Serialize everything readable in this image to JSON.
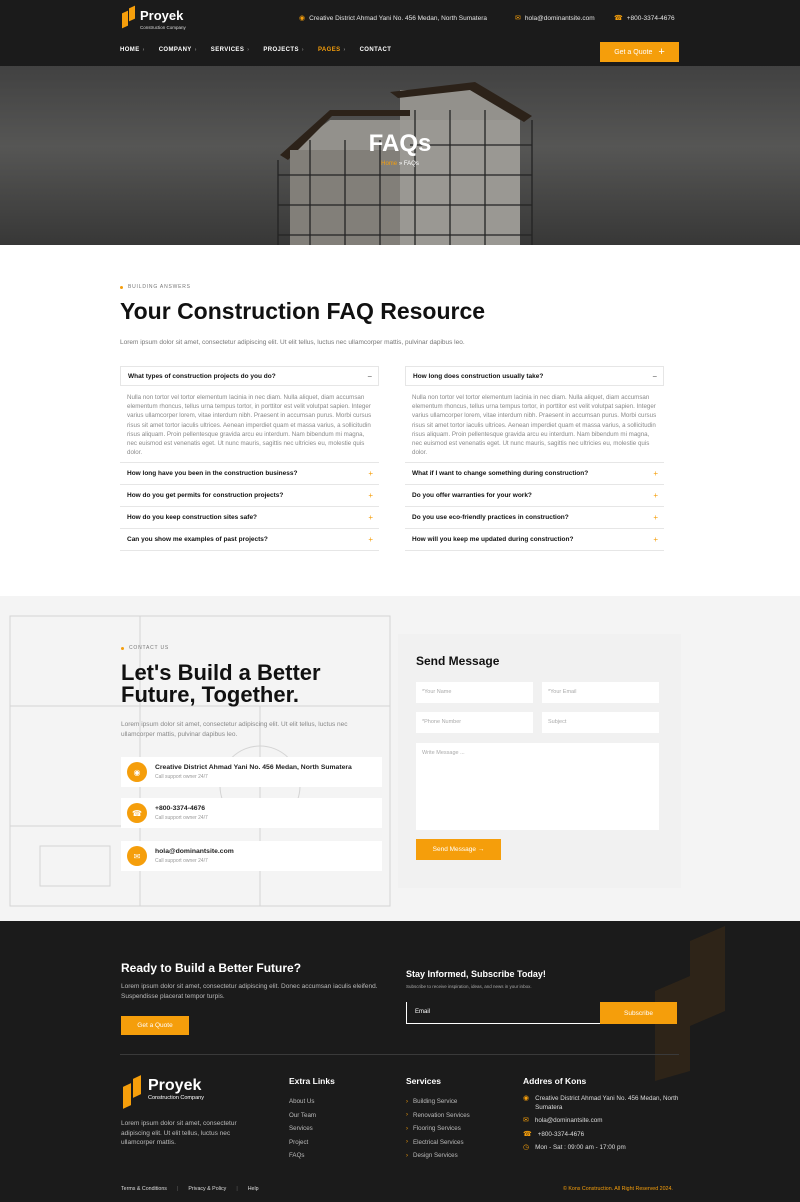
{
  "colors": {
    "accent": "#f59e0b",
    "dark": "#1b1b1b"
  },
  "header": {
    "logo_name": "Proyek",
    "logo_tagline": "Construction Company",
    "address": "Creative District Ahmad Yani No. 456 Medan, North Sumatera",
    "email": "hola@dominantsite.com",
    "phone": "+800-3374-4676",
    "nav": [
      "HOME",
      "COMPANY",
      "SERVICES",
      "PROJECTS",
      "PAGES",
      "CONTACT"
    ],
    "nav_active": "PAGES",
    "quote_label": "Get a Quote",
    "quote_icon": "plus-icon"
  },
  "hero": {
    "title": "FAQs",
    "crumb_home": "Home",
    "crumb_sep": " » ",
    "crumb_current": "FAQs"
  },
  "faq": {
    "eyebrow": "BUILDING ANSWERS",
    "title": "Your Construction FAQ Resource",
    "intro": "Lorem ipsum dolor sit amet, consectetur adipiscing elit. Ut elit tellus, luctus nec ullamcorper mattis, pulvinar dapibus leo.",
    "left": [
      {
        "q": "What types of construction projects do you do?",
        "open": true,
        "sign": "−"
      },
      {
        "q": "How long have you been in the construction business?",
        "sign": "+"
      },
      {
        "q": "How do you get permits for construction projects?",
        "sign": "+"
      },
      {
        "q": "How do you keep construction sites safe?",
        "sign": "+"
      },
      {
        "q": "Can you show me examples of past projects?",
        "sign": "+"
      }
    ],
    "right": [
      {
        "q": "How long does construction usually take?",
        "open": true,
        "sign": "−"
      },
      {
        "q": "What if I want to change something during construction?",
        "sign": "+"
      },
      {
        "q": "Do you offer warranties for your work?",
        "sign": "+"
      },
      {
        "q": "Do you use eco-friendly practices in construction?",
        "sign": "+"
      },
      {
        "q": "How will you keep me updated during construction?",
        "sign": "+"
      }
    ],
    "answer": "Nulla non tortor vel tortor elementum lacinia in nec diam. Nulla aliquet, diam accumsan elementum rhoncus, tellus urna tempus tortor, in porttitor est velit volutpat sapien. Integer varius ullamcorper lorem, vitae interdum nibh. Praesent in accumsan purus. Morbi cursus risus sit amet tortor iaculis ultrices. Aenean imperdiet quam et massa varius, a sollicitudin risus aliquam. Proin pellentesque gravida arcu eu interdum. Nam bibendum mi magna, nec euismod est venenatis eget. Ut nunc mauris, sagittis nec ultricies eu, molestie quis dolor."
  },
  "contact": {
    "eyebrow": "CONTACT US",
    "title": "Let's Build a Better Future, Together.",
    "text": "Lorem ipsum dolor sit amet, consectetur adipiscing elit. Ut elit tellus, luctus nec ullamcorper mattis, pulvinar dapibus leo.",
    "cards": [
      {
        "icon": "location-pin-icon",
        "main": "Creative District Ahmad Yani No. 456 Medan, North Sumatera",
        "sub": "Call support owner 24/7"
      },
      {
        "icon": "phone-icon",
        "main": "+800-3374-4676",
        "sub": "Call support owner 24/7"
      },
      {
        "icon": "mail-icon",
        "main": "hola@dominantsite.com",
        "sub": "Call support owner 24/7"
      }
    ],
    "form": {
      "title": "Send Message",
      "name": "*Your Name",
      "email": "*Your Email",
      "phone": "*Phone Number",
      "subject": "Subject",
      "message": "Write Message ...",
      "button": "Send Message →"
    }
  },
  "footer": {
    "cta_title": "Ready to Build a Better Future?",
    "cta_text": "Lorem ipsum dolor sit amet, consectetur adipiscing elit. Donec accumsan iaculis eleifend. Suspendisse placerat tempor turpis.",
    "cta_button": "Get a Quote",
    "sub_title": "Stay Informed, Subscribe Today!",
    "sub_text": "Subscribe to receive inspiration, ideas, and news in your inbox.",
    "sub_placeholder": "Email",
    "sub_button": "Subscribe",
    "logo_name": "Proyek",
    "logo_tagline": "Construction Company",
    "about": "Lorem ipsum dolor sit amet, consectetur adipiscing elit. Ut elit tellus, luctus nec ullamcorper mattis.",
    "extra_title": "Extra Links",
    "extra_links": [
      "About Us",
      "Our Team",
      "Services",
      "Project",
      "FAQs"
    ],
    "services_title": "Services",
    "services": [
      "Building Service",
      "Renovation Services",
      "Flooring Services",
      "Electrical Services",
      "Design Services"
    ],
    "address_title": "Addres of Kons",
    "address": "Creative District Ahmad Yani No. 456 Medan, North Sumatera",
    "email": "hola@dominantsite.com",
    "phone": "+800-3374-4676",
    "hours": "Mon - Sat : 09:00 am - 17:00 pm",
    "bottom_links": [
      "Terms & Conditions",
      "Privacy & Policy",
      "Help"
    ],
    "copyright": "© Kons Construction. All Right Reserved 2024."
  }
}
